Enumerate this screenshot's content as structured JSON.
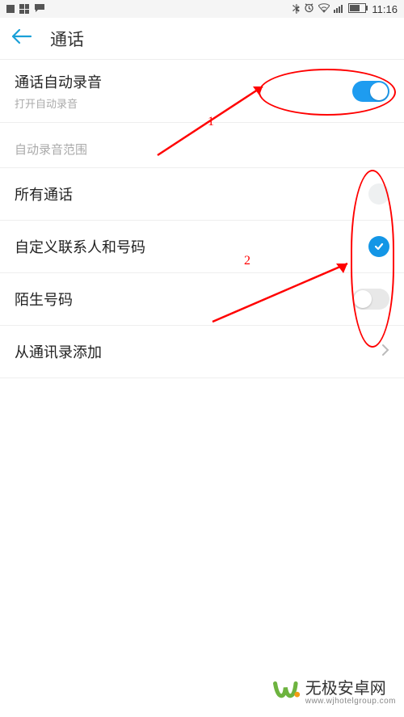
{
  "status": {
    "time": "11:16"
  },
  "header": {
    "title": "通话"
  },
  "autoRecord": {
    "title": "通话自动录音",
    "subtitle": "打开自动录音",
    "enabled": true
  },
  "sectionLabel": "自动录音范围",
  "scope": {
    "allCalls": {
      "label": "所有通话",
      "selected": false
    },
    "customContacts": {
      "label": "自定义联系人和号码",
      "selected": true
    },
    "unknownNumbers": {
      "label": "陌生号码",
      "enabled": false
    }
  },
  "addFromContacts": {
    "label": "从通讯录添加"
  },
  "annotations": {
    "label1": "1",
    "label2": "2"
  },
  "watermark": {
    "brand": "无极安卓网",
    "url": "www.wjhotelgroup.com"
  }
}
